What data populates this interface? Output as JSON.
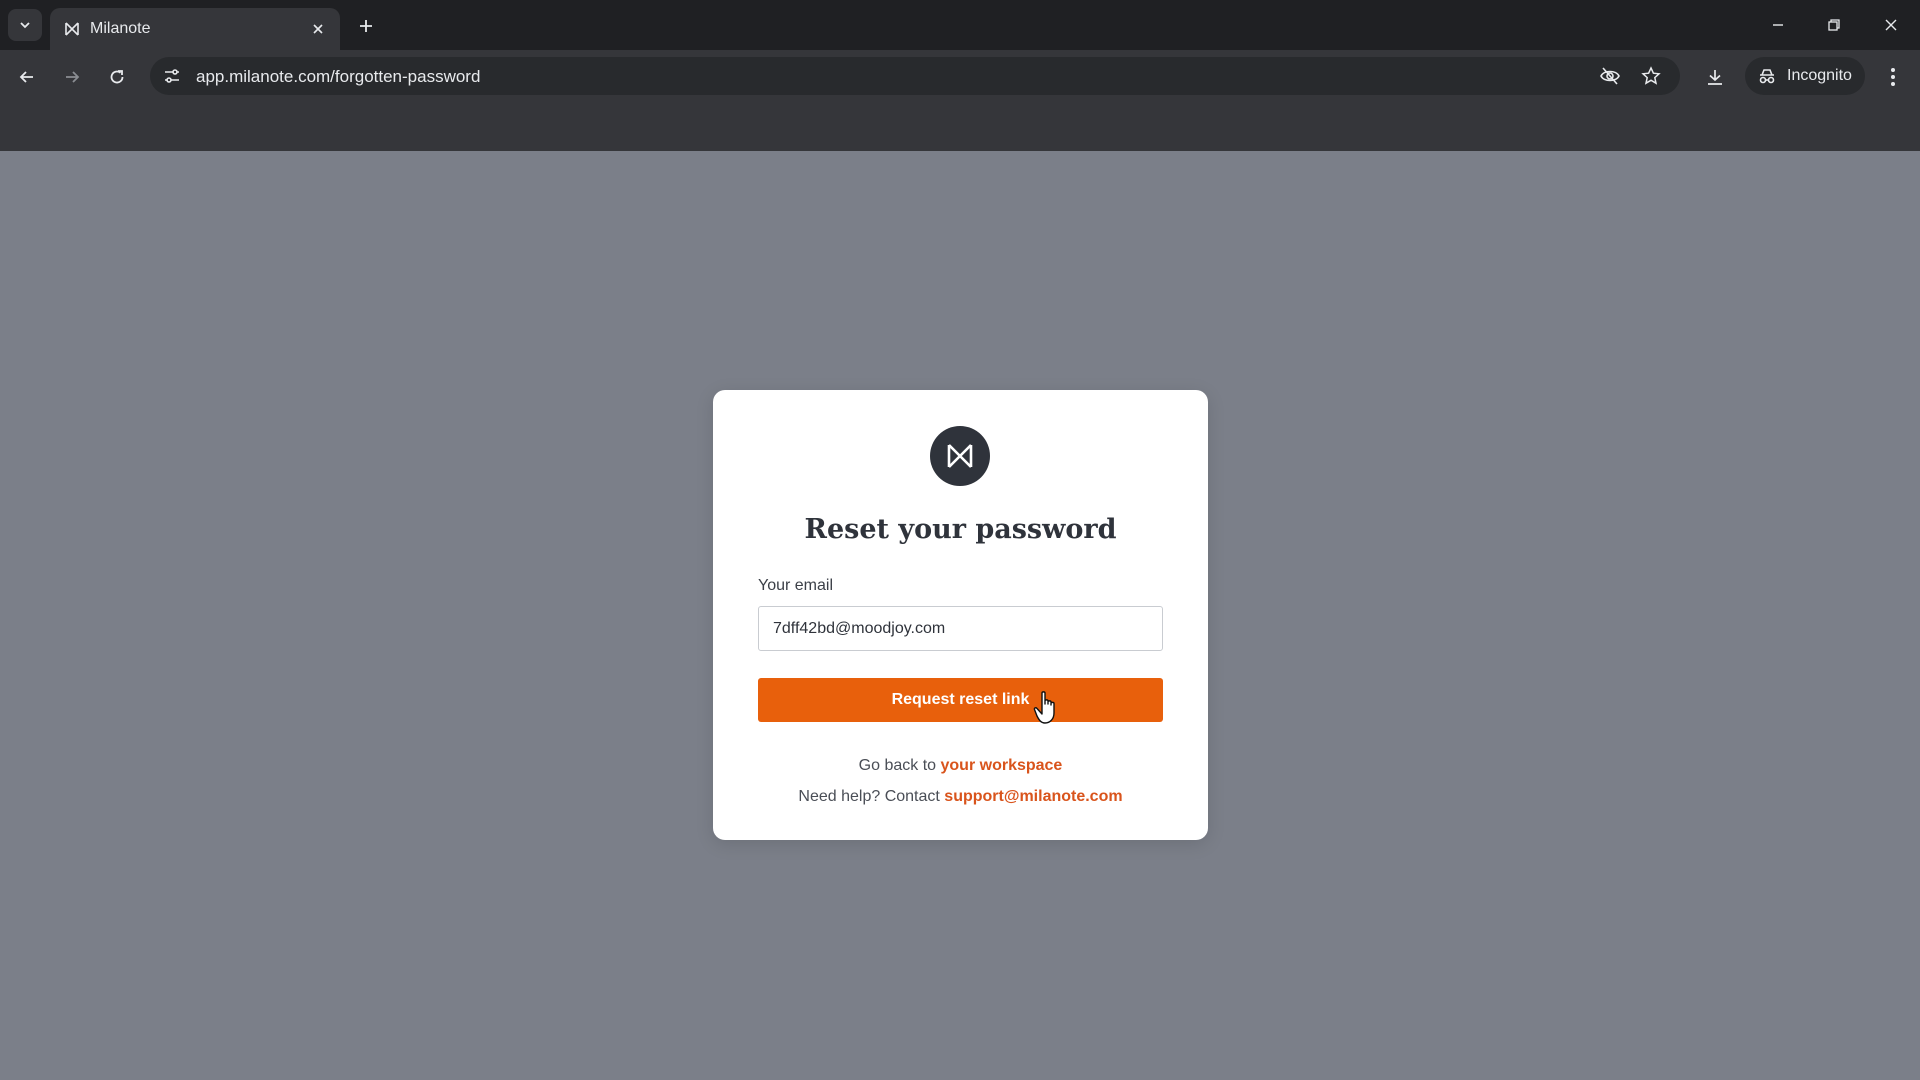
{
  "browser": {
    "tab_title": "Milanote",
    "url": "app.milanote.com/forgotten-password",
    "incognito_label": "Incognito"
  },
  "card": {
    "title": "Reset your password",
    "email_label": "Your email",
    "email_value": "7dff42bd@moodjoy.com",
    "submit_label": "Request reset link",
    "back_text": "Go back to",
    "back_link": "your workspace",
    "help_text": "Need help? Contact",
    "help_link": "support@milanote.com"
  },
  "colors": {
    "accent": "#e8600c",
    "link": "#d9541c",
    "backdrop": "#7b7f89",
    "logo_bg": "#2f333b"
  }
}
